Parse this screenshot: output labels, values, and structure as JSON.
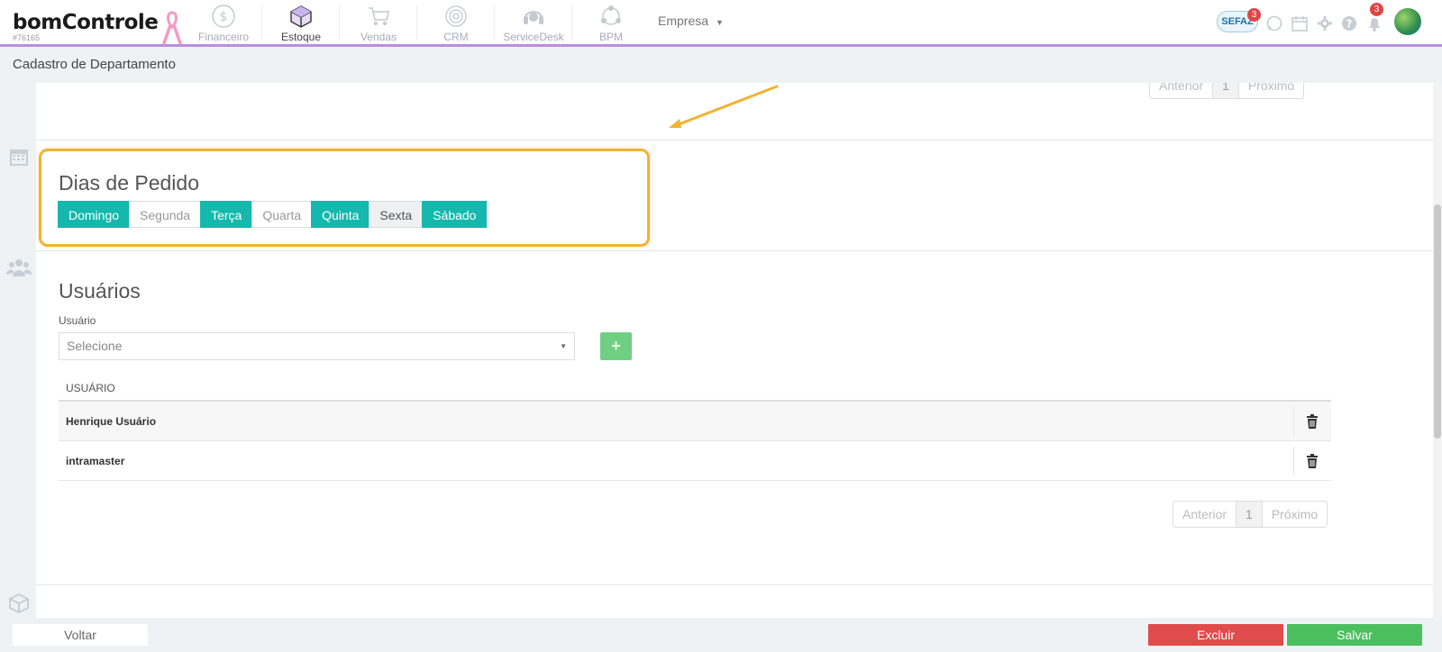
{
  "header": {
    "logo_text": "bomControle",
    "account_id": "#76165",
    "nav": [
      {
        "label": "Financeiro",
        "icon": "dollar-circle-icon"
      },
      {
        "label": "Estoque",
        "icon": "box-icon",
        "active": true
      },
      {
        "label": "Vendas",
        "icon": "cart-icon"
      },
      {
        "label": "CRM",
        "icon": "target-icon"
      },
      {
        "label": "ServiceDesk",
        "icon": "headset-icon"
      },
      {
        "label": "BPM",
        "icon": "network-icon"
      }
    ],
    "empresa_label": "Empresa",
    "sefaz_label": "SEFAZ",
    "sefaz_badge": "3",
    "notifications_badge": "3"
  },
  "page": {
    "title": "Cadastro de Departamento"
  },
  "top_pager": {
    "prev": "Anterior",
    "current": "1",
    "next": "Próximo"
  },
  "dias": {
    "title": "Dias de Pedido",
    "days": [
      {
        "label": "Domingo",
        "selected": true
      },
      {
        "label": "Segunda",
        "selected": false
      },
      {
        "label": "Terça",
        "selected": true
      },
      {
        "label": "Quarta",
        "selected": false
      },
      {
        "label": "Quinta",
        "selected": true
      },
      {
        "label": "Sexta",
        "selected": false
      },
      {
        "label": "Sábado",
        "selected": true
      }
    ]
  },
  "usuarios": {
    "title": "Usuários",
    "field_label": "Usuário",
    "select_placeholder": "Selecione",
    "add_label": "+",
    "column_header": "USUÁRIO",
    "rows": [
      "Henrique Usuário",
      "intramaster"
    ]
  },
  "bottom_pager": {
    "prev": "Anterior",
    "current": "1",
    "next": "Próximo"
  },
  "footer": {
    "back_label": "Voltar",
    "delete_label": "Excluir",
    "save_label": "Salvar"
  },
  "colors": {
    "accent_teal": "#14b8ac",
    "highlight": "#f2b233",
    "danger": "#e04b4b",
    "success": "#4cbf5e"
  }
}
